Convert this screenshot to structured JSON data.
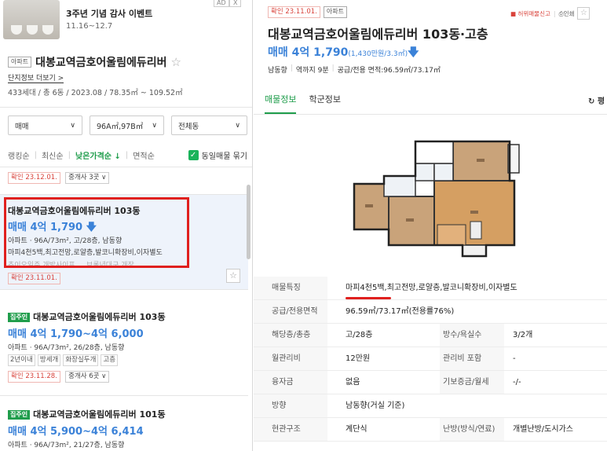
{
  "ad": {
    "title": "3주년 기념 감사 이벤트",
    "date": "11.16~12.7",
    "ad_label": "AD",
    "close_label": "X"
  },
  "complex": {
    "tag": "아파트",
    "name": "대봉교역금호어울림에듀리버",
    "more_link": "단지정보 더보기 >",
    "info": "433세대 / 총 6동 / 2023.08 / 78.35㎡ ~ 109.52㎡"
  },
  "filters": {
    "trade": "매매",
    "area": "96A㎡,97B㎡",
    "building": "전체동"
  },
  "sort": {
    "ranking": "랭킹순",
    "latest": "최신순",
    "low_price": "낮은가격순 ↓",
    "area": "면적순",
    "same_listing": "동일매물 묶기"
  },
  "list": {
    "top_confirm": "확인 23.12.01.",
    "top_broker": "중개사 3곳 ∨",
    "items": [
      {
        "name": "대봉교역금호어울림에듀리버 103동",
        "price": "매매 4억 1,790",
        "arrow": "🡇",
        "spec": "아파트 · 96A/73m², 고/28층, 남동향",
        "desc": "마피4천5백,최고전망,로얄층,발코니확장비,이자별도",
        "cut": "추이오일주 개방사이프 ... 브롤년대구 개장",
        "confirm": "확인 23.11.01."
      },
      {
        "tag": "집주인",
        "name": "대봉교역금호어울림에듀리버 103동",
        "price": "매매 4억 1,790~4억 6,000",
        "spec": "아파트 · 96A/73m², 26/28층, 남동향",
        "tags": [
          "2년이내",
          "방세개",
          "화장실두개",
          "고층"
        ],
        "confirm": "확인 23.11.28.",
        "broker": "중개사 6곳 ∨"
      },
      {
        "tag": "집주인",
        "name": "대봉교역금호어울림에듀리버 101동",
        "price": "매매 4억 5,900~4억 6,414",
        "spec": "아파트 · 96A/73m², 21/27층, 남동향"
      }
    ]
  },
  "detail": {
    "confirm": "확인 23.11.01.",
    "tag": "아파트",
    "report": "허위매물신고",
    "print": "인쇄",
    "title": "대봉교역금호어울림에듀리버 103동·고층",
    "price": "매매 4억 1,790",
    "price_per": "(1,430만원/3.3㎡)",
    "arrow": "🡇",
    "meta": [
      "남동향",
      "역까지 9분",
      "공급/전용 면적:96.59㎡/73.17㎡"
    ],
    "tabs": [
      "매물정보",
      "학군정보"
    ],
    "tab_right": "↻ 평",
    "rows": [
      {
        "k": "매물특징",
        "v": "마피4천5백,최고전망,로얄층,발코니확장비,이자별도"
      },
      {
        "k": "공급/전용면적",
        "v": "96.59㎡/73.17㎡(전용률76%)"
      },
      {
        "k": "해당층/총층",
        "v": "고/28층",
        "k2": "방수/욕실수",
        "v2": "3/2개"
      },
      {
        "k": "월관리비",
        "v": "12만원",
        "k2": "관리비 포함",
        "v2": "-"
      },
      {
        "k": "융자금",
        "v": "없음",
        "k2": "기보증금/월세",
        "v2": "-/-"
      },
      {
        "k": "방향",
        "v": "남동향(거실 기준)"
      },
      {
        "k": "현관구조",
        "v": "계단식",
        "k2": "난방(방식/연료)",
        "v2": "개별난방/도시가스"
      }
    ]
  },
  "colors": {
    "accent_green": "#1f9d4b",
    "price_blue": "#3b82d8",
    "highlight_red": "#e0201e"
  }
}
